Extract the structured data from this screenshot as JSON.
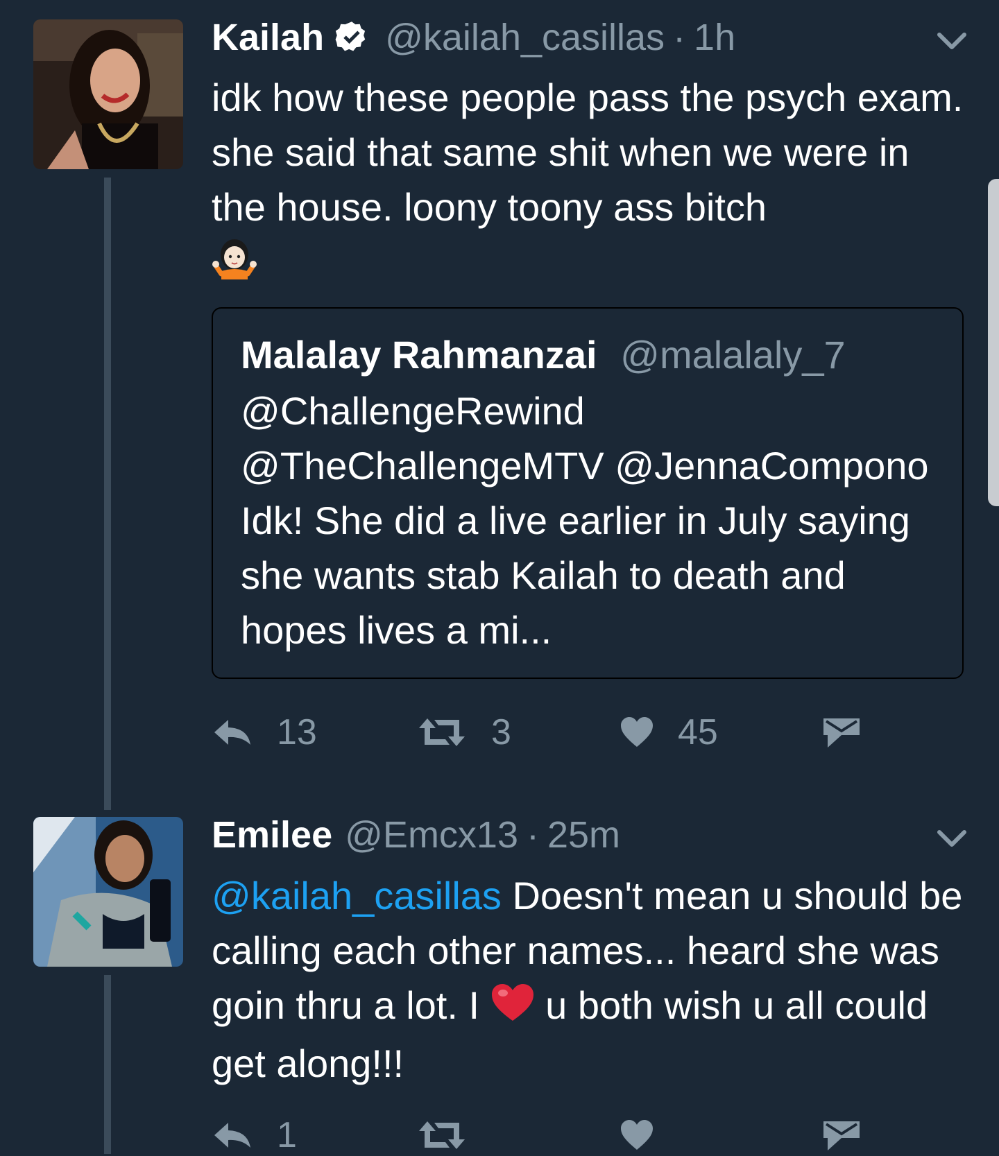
{
  "colors": {
    "background": "#1b2836",
    "secondary_text": "#8899a6",
    "mention": "#1da1f2",
    "heart": "#e0243a"
  },
  "tweets": [
    {
      "name": "Kailah",
      "verified": true,
      "handle": "@kailah_casillas",
      "separator": "·",
      "time": "1h",
      "text": "idk how these people pass the psych exam. she said that same shit when we were in the house. loony toony ass bitch",
      "trailing_emoji": "person-shrugging",
      "quoted": {
        "name": "Malalay Rahmanzai",
        "handle": "@malalaly_7",
        "text": "@ChallengeRewind @TheChallengeMTV @JennaCompono Idk! She did a live earlier in July saying she wants stab Kailah to death and hopes lives a mi..."
      },
      "stats": {
        "replies": "13",
        "retweets": "3",
        "likes": "45"
      }
    },
    {
      "name": "Emilee",
      "handle": "@Emcx13",
      "separator": "·",
      "time": "25m",
      "mention": "@kailah_casillas",
      "text_part1": "Doesn't mean u should be calling each other names... heard she was goin thru a lot. I",
      "inline_emoji": "red-heart",
      "text_part2": "u both wish u all could get along!!!",
      "stats": {
        "replies": "1"
      }
    }
  ],
  "icons": [
    "verified-badge-icon",
    "chevron-down-icon",
    "reply-icon",
    "retweet-icon",
    "heart-icon",
    "direct-message-icon",
    "shrug-emoji-icon",
    "red-heart-emoji-icon"
  ]
}
